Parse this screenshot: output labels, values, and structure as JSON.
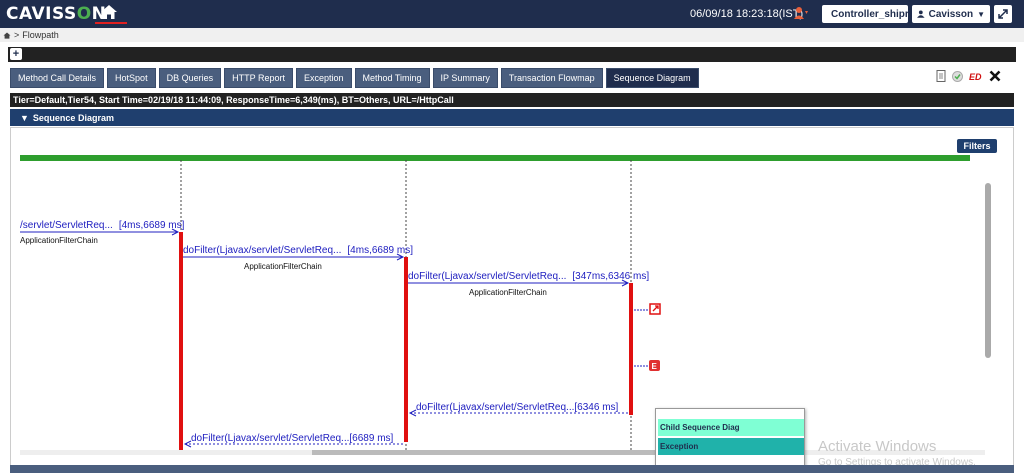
{
  "header": {
    "logo_prefix": "CAVISS",
    "logo_o": "O",
    "logo_suffix": "N",
    "datetime": "06/09/18 18:23:18(IST)",
    "controller_label": "Controller_shipra",
    "user_label": "Cavisson",
    "colors": {
      "bar": "#1f2d4d",
      "accent": "#e02020"
    }
  },
  "breadcrumb": {
    "current": "Flowpath"
  },
  "tabs": [
    {
      "label": "Method Call Details"
    },
    {
      "label": "HotSpot"
    },
    {
      "label": "DB Queries"
    },
    {
      "label": "HTTP Report"
    },
    {
      "label": "Exception"
    },
    {
      "label": "Method Timing"
    },
    {
      "label": "IP Summary"
    },
    {
      "label": "Transaction Flowmap"
    },
    {
      "label": "Sequence Diagram",
      "active": true
    }
  ],
  "info": "Tier=Default,Tier54, Start Time=02/19/18 11:44:09, ResponseTime=6,349(ms), BT=Others, URL=/HttpCall",
  "section_title": "Sequence Diagram",
  "filters_label": "Filters",
  "progress": {
    "percent": 100,
    "color": "#2e9e2e"
  },
  "sequence": {
    "calls": [
      {
        "label": "/servlet/ServletReq...",
        "timing": "[4ms,6689 ms]",
        "class": "ApplicationFilterChain"
      },
      {
        "label": "doFilter(Ljavax/servlet/ServletReq...",
        "timing": "[4ms,6689 ms]",
        "class": "ApplicationFilterChain"
      },
      {
        "label": "doFilter(Ljavax/servlet/ServletReq...",
        "timing": "[347ms,6346 ms]",
        "class": "ApplicationFilterChain"
      }
    ],
    "returns": [
      {
        "label": "doFilter(Ljavax/servlet/ServletReq...",
        "timing": "[6346 ms]"
      },
      {
        "label": "doFilter(Ljavax/servlet/ServletReq...",
        "timing": "[6689 ms]"
      }
    ],
    "exception_badge": "E",
    "colors": {
      "line": "#2020c0",
      "activation": "#e01010"
    }
  },
  "popup": {
    "items": [
      {
        "label": "Child Sequence Diag"
      },
      {
        "label": "Exception"
      }
    ]
  },
  "watermark": {
    "title": "Activate Windows",
    "subtitle": "Go to Settings to activate Windows."
  }
}
